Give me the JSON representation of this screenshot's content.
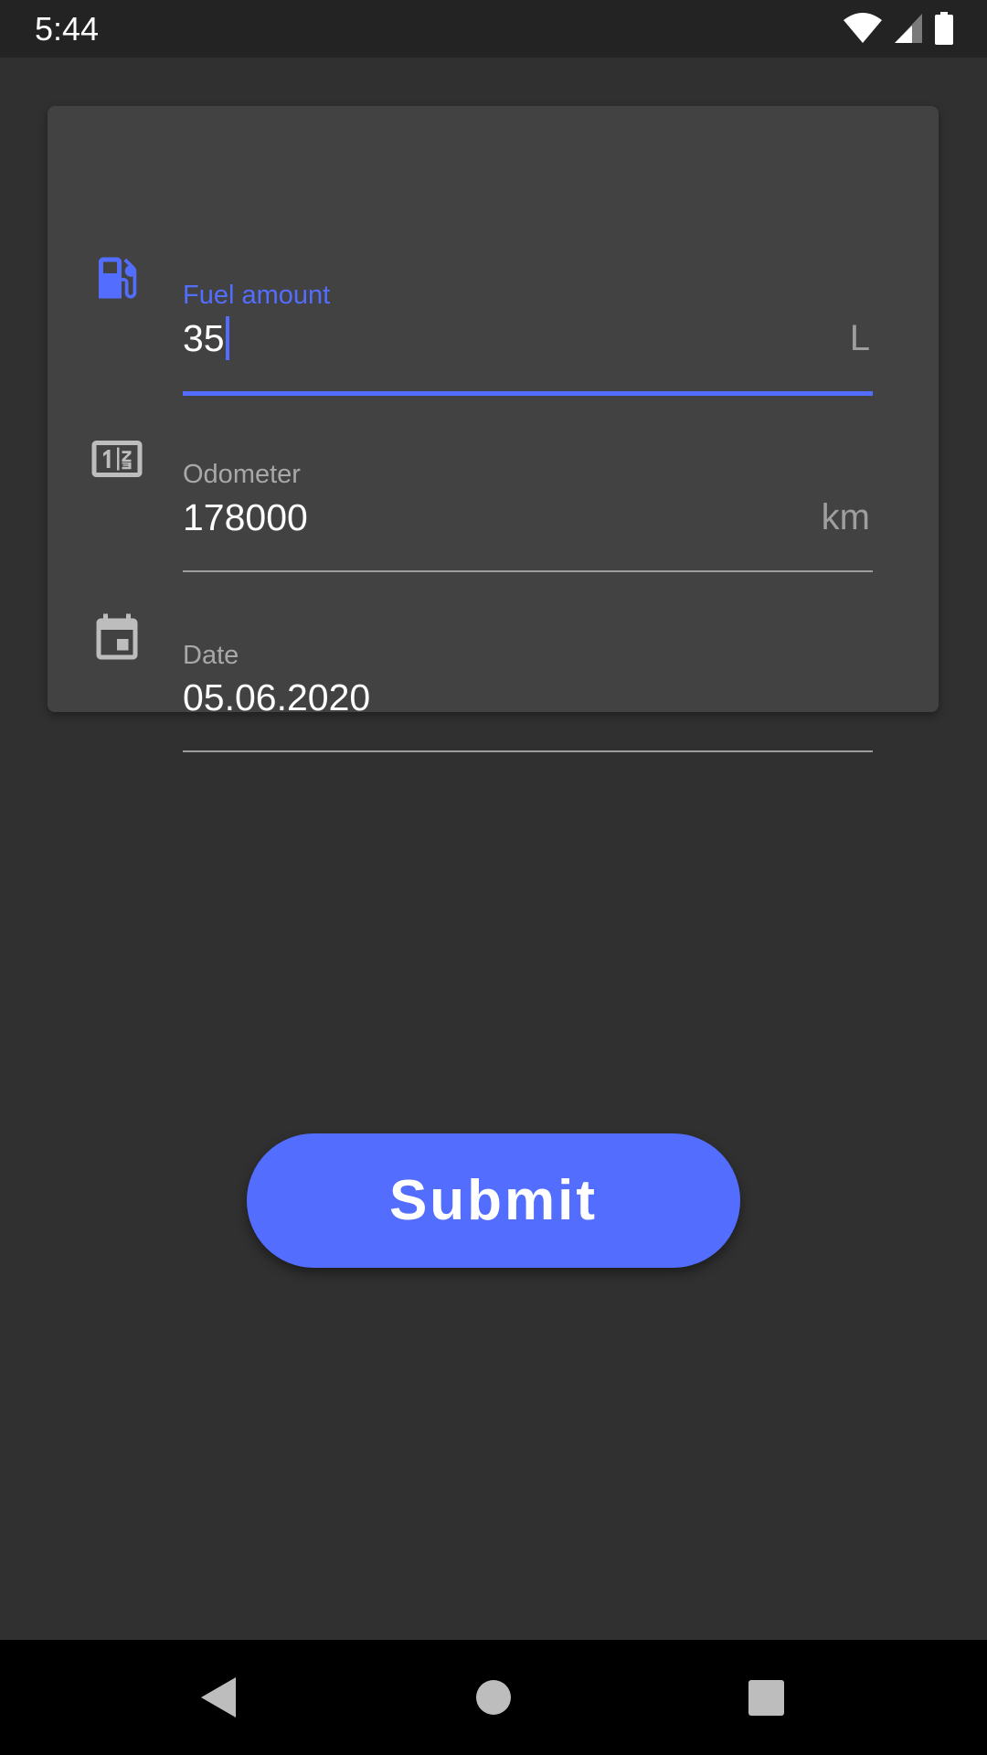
{
  "status_bar": {
    "time": "5:44",
    "icons": [
      "wifi-icon",
      "cell-signal-icon",
      "battery-icon"
    ]
  },
  "form": {
    "fuel": {
      "icon": "fuel-pump-icon",
      "label": "Fuel amount",
      "value": "35",
      "suffix": "L",
      "focused": true
    },
    "odometer": {
      "icon": "odometer-icon",
      "label": "Odometer",
      "value": "178000",
      "suffix": "km"
    },
    "date": {
      "icon": "calendar-icon",
      "label": "Date",
      "value": "05.06.2020"
    }
  },
  "submit": {
    "label": "Submit"
  },
  "nav_bar": {
    "buttons": [
      "back-icon",
      "home-icon",
      "recents-icon"
    ]
  },
  "colors": {
    "background": "#303030",
    "card": "#424242",
    "accent": "#536dfe",
    "label_muted": "#a8a8a8",
    "text": "#ffffff",
    "icon_muted": "#bdbdbd"
  }
}
